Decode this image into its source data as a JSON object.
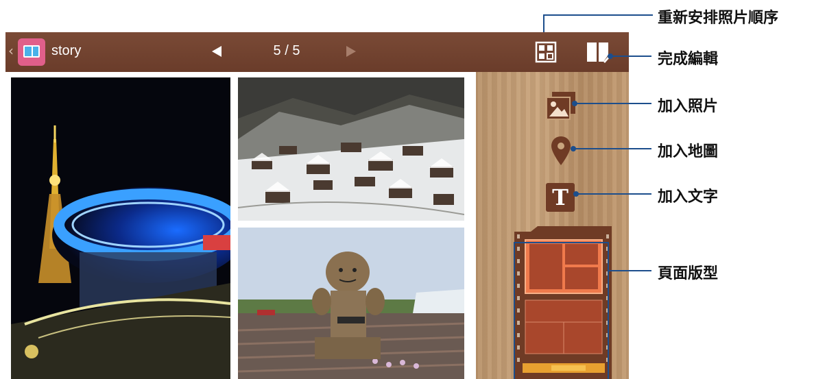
{
  "app": {
    "title": "story",
    "page_indicator": "5 / 5"
  },
  "icons": {
    "back": "chevron-left-icon",
    "app": "photo-album-app-icon",
    "prev": "triangle-left-icon",
    "next": "triangle-right-icon",
    "rearrange": "grid-rearrange-icon",
    "finish": "book-edit-icon",
    "add_photo": "add-photo-icon",
    "add_map": "map-pin-icon",
    "add_text": "text-T-icon"
  },
  "photos": [
    {
      "subject": "Nagoya TV tower and Oasis 21 at night"
    },
    {
      "subject": "snowy village with thatched houses"
    },
    {
      "subject": "straw figure in a flower field"
    }
  ],
  "add_text_glyph": "T",
  "callouts": {
    "rearrange": "重新安排照片順序",
    "finish": "完成編輯",
    "add_photo": "加入照片",
    "add_map": "加入地圖",
    "add_text": "加入文字",
    "page_layout": "頁面版型"
  },
  "colors": {
    "topbar": "#6f412e",
    "callout": "#1c4e8c",
    "button_brown": "#6f3b25",
    "layout_selected": "#f07a4c"
  }
}
